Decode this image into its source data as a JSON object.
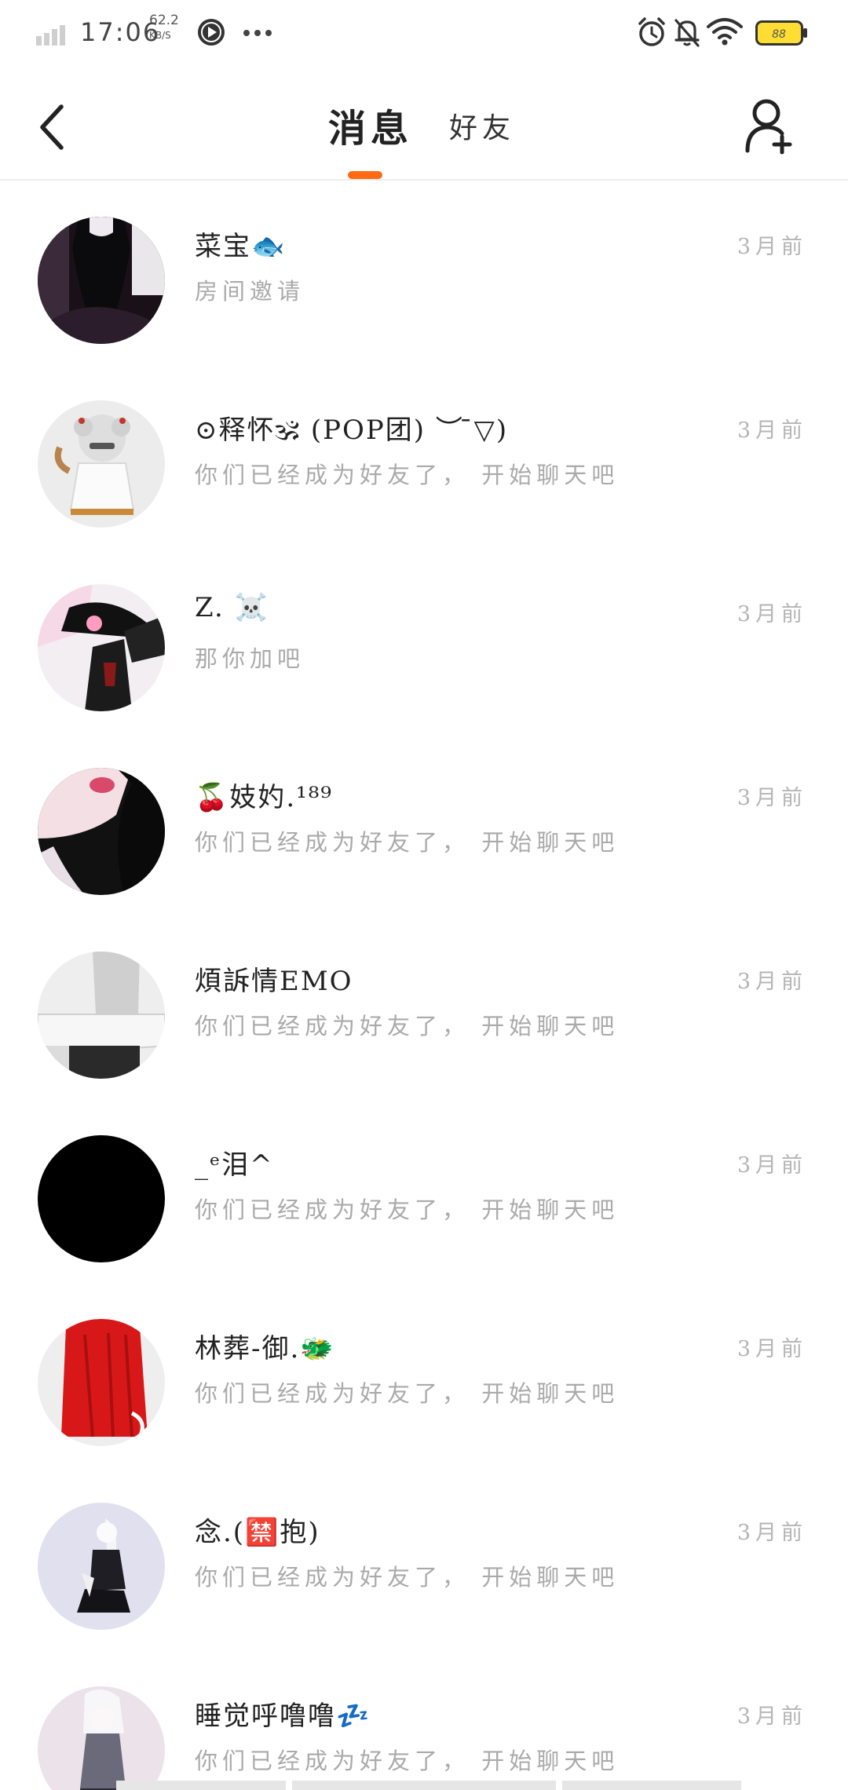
{
  "status_bar": {
    "time": "17:06",
    "net_speed_value": "62.2",
    "net_speed_unit": "KB/S",
    "battery_level": "88"
  },
  "nav": {
    "tab_messages": "消息",
    "tab_friends": "好友",
    "active_tab_color": "#ff6a13"
  },
  "icons": {
    "back": "chevron-left-icon",
    "add_friend": "add-user-icon",
    "more": "more-horizontal-icon"
  },
  "conversations": [
    {
      "name": "菜宝🐟",
      "message": "房间邀请",
      "time": "3月前"
    },
    {
      "name": "⊙释怀🕉 (POP团) ︶ ̄▽)",
      "message": "你们已经成为好友了， 开始聊天吧",
      "time": "3月前"
    },
    {
      "name": "Z. ☠️",
      "message": "那你加吧",
      "time": "3月前"
    },
    {
      "name": "🍒妓妁.¹⁸⁹",
      "message": "你们已经成为好友了， 开始聊天吧",
      "time": "3月前"
    },
    {
      "name": "煩訴情EMO",
      "message": "你们已经成为好友了， 开始聊天吧",
      "time": "3月前"
    },
    {
      "name": "_ᵉ泪^",
      "message": "你们已经成为好友了， 开始聊天吧",
      "time": "3月前"
    },
    {
      "name": "林葬-御.🐲",
      "message": "你们已经成为好友了， 开始聊天吧",
      "time": "3月前"
    },
    {
      "name": "念.(🈲抱)",
      "message": "你们已经成为好友了， 开始聊天吧",
      "time": "3月前"
    },
    {
      "name": "睡觉呼噜噜💤",
      "message": "你们已经成为好友了， 开始聊天吧",
      "time": "3月前"
    }
  ]
}
